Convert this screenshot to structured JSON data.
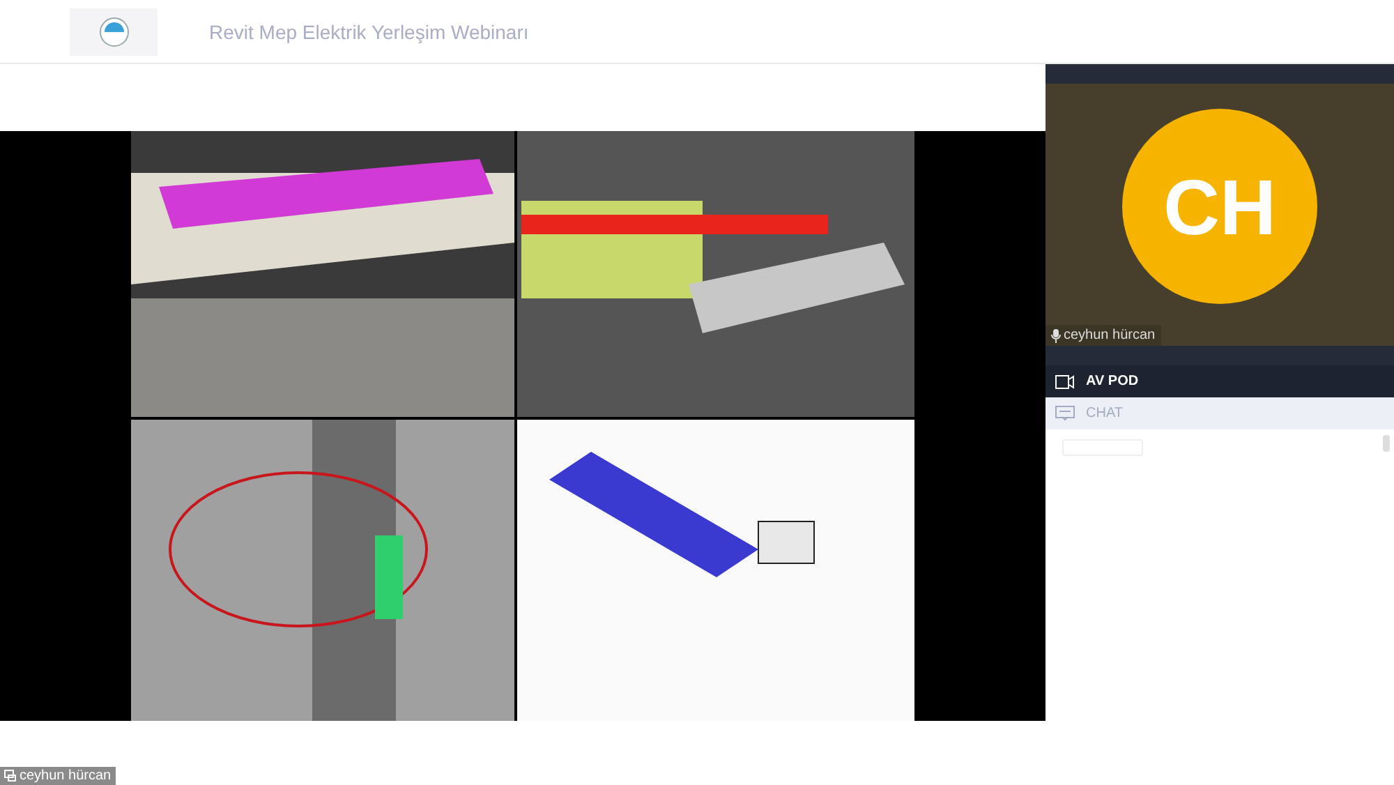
{
  "header": {
    "title": "Revit Mep Elektrik Yerleşim Webinarı"
  },
  "stage": {
    "kind": "picture",
    "presenter_label": "ceyhun hürcan"
  },
  "sidebar": {
    "camera": {
      "initials": "CH",
      "name": "ceyhun hürcan",
      "mic_on": true
    },
    "pods": [
      {
        "label": "AV POD",
        "selected": true,
        "kind": "video"
      },
      {
        "label": "CHAT",
        "selected": false,
        "kind": "chat"
      }
    ]
  }
}
